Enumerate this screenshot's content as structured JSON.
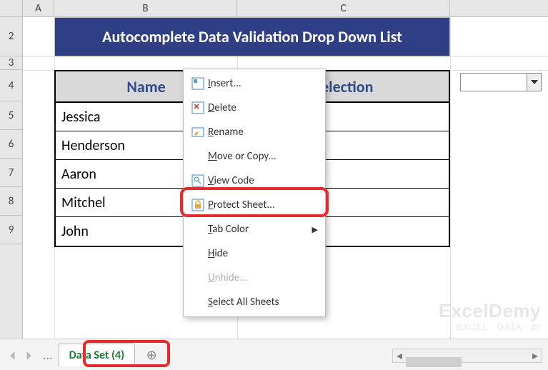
{
  "columns": {
    "A": "A",
    "B": "B",
    "C": "C"
  },
  "rows": {
    "r2": "2",
    "r3": "3",
    "r4": "4",
    "r5": "5",
    "r6": "6",
    "r7": "7",
    "r8": "8",
    "r9": "9"
  },
  "title": "Autocomplete Data Validation Drop Down List",
  "table": {
    "headers": {
      "name": "Name",
      "selection": "Selection"
    },
    "data": [
      "Jessica",
      "Henderson",
      "Aaron",
      "Mitchel",
      "John"
    ]
  },
  "context_menu": {
    "insert": "Insert...",
    "delete": "Delete",
    "rename": "Rename",
    "move": "Move or Copy...",
    "view_code": "View Code",
    "protect": "Protect Sheet...",
    "tab_color": "Tab Color",
    "hide": "Hide",
    "unhide": "Unhide...",
    "select_all": "Select All Sheets"
  },
  "sheet_tab": "Data Set (4)",
  "dots": "...",
  "plus": "+",
  "watermark": {
    "l1": "ExcelDemy",
    "l2": "EXCEL · DATA · BI"
  }
}
